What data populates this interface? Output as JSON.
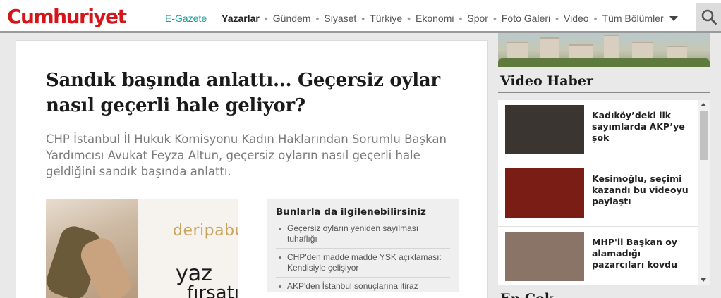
{
  "header": {
    "logo": "Cumhuriyet",
    "nav": [
      {
        "label": "E-Gazete",
        "style": "egazete"
      },
      {
        "label": "Yazarlar",
        "style": "bold"
      },
      {
        "label": "Gündem",
        "style": ""
      },
      {
        "label": "Siyaset",
        "style": ""
      },
      {
        "label": "Türkiye",
        "style": ""
      },
      {
        "label": "Ekonomi",
        "style": ""
      },
      {
        "label": "Spor",
        "style": ""
      },
      {
        "label": "Foto Galeri",
        "style": ""
      },
      {
        "label": "Video",
        "style": ""
      },
      {
        "label": "Tüm Bölümler",
        "style": "more"
      }
    ],
    "search_icon": "search-icon"
  },
  "article": {
    "headline": "Sandık başında anlattı... Geçersiz oylar nasıl geçerli hale geliyor?",
    "summary": "CHP İstanbul İl Hukuk Komisyonu Kadın Haklarından Sorumlu Başkan Yardımcısı Avukat Feyza Altun, geçersiz oyların nasıl geçerli hale geldiğini sandık başında anlattı.",
    "ad": {
      "brand": "deripabuç",
      "line1": "yaz",
      "line2": "fırsatı"
    },
    "related": {
      "title": "Bunlarla da ilgilenebilirsiniz",
      "items": [
        "Geçersiz oyların yeniden sayılması tuhaflığı",
        "CHP'den madde madde YSK açıklaması: Kendisiyle çelişiyor",
        "AKP'den İstanbul sonuçlarına itiraz"
      ]
    }
  },
  "sidebar": {
    "video_title": "Video Haber",
    "videos": [
      {
        "title": "Kadıköy’deki ilk sayımlarda AKP’ye şok",
        "thumb": "#3a3530"
      },
      {
        "title": "Kesimoğlu, seçimi kazandı bu videoyu paylaştı",
        "thumb": "#7a1d14"
      },
      {
        "title": "MHP'li Başkan oy alamadığı pazarcıları kovdu",
        "thumb": "#8a7468"
      }
    ],
    "next_title": "En Çok"
  },
  "colors": {
    "brand": "#d4151a",
    "egazete": "#1e9c9c"
  }
}
